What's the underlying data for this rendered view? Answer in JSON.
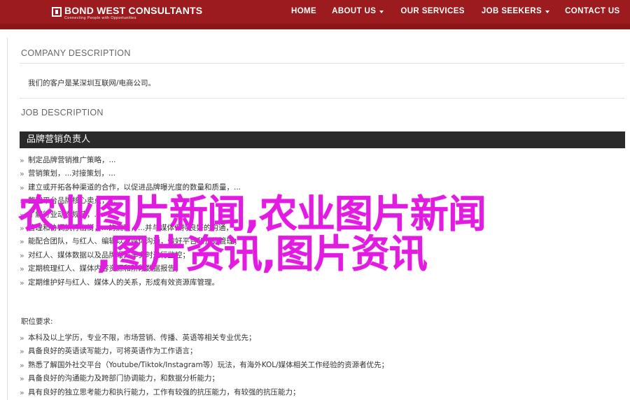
{
  "header": {
    "logo_name": "BOND WEST CONSULTANTS",
    "logo_tagline": "Connecting People with Opportunities",
    "nav": [
      {
        "label": "HOME"
      },
      {
        "label": "ABOUT US"
      },
      {
        "label": "OUR SERVICES"
      },
      {
        "label": "JOB SEEKERS"
      },
      {
        "label": "CONTACT US"
      }
    ],
    "bg_color": "#9b1b1e"
  },
  "company": {
    "heading": "COMPANY DESCRIPTION",
    "text": "我们的客户是某深圳互联网/电商公司。"
  },
  "job": {
    "heading": "JOB DESCRIPTION",
    "title": "品牌营销负责人",
    "duties": [
      "制定品牌营销推广策略，...",
      "营销策划，...对接策划，...",
      "建立或开拓各种渠道的合作，以促进品牌曝光度的数量和质量，...",
      "整理平台品牌核心卖点，...",
      "了解行业动态规范，...",
      "管理和协调执行出街，...的流程，...并与媒体保持良好的沟通，...",
      "能配合团队，与红人、编辑以及媒体沟通，做好平台和预算管理；",
      "对红人、媒体数据以及品牌曝光率实时进行监控；",
      "定期梳理红人、媒体内容资源和阶段数据报告；",
      "定期维护好与红人、媒体人的关系，形成有效资源库管理。"
    ],
    "requirements_label": "职位要求:",
    "requirements": [
      "本科及以上学历，专业不限，市场营销、传播、英语等相关专业优先；",
      "具备良好的英语读写能力，可将英语作为工作语言；",
      "熟悉了解国外社交平台（Youtube/Tiktok/Instagram等）玩法，有海外KOL/媒体相关工作经验的资源者优先；",
      "具备良好的沟通能力及跨部门协调能力，和数据分析能力；",
      "具有良好的独立思考能力和执行能力，工作有较强的抗压能力，有较强的抗压能力；"
    ]
  },
  "watermark": {
    "line1": "农业图片新闻,农业图片新闻",
    "line2": ",图片资讯,图片资讯",
    "color": "#e21be0"
  }
}
